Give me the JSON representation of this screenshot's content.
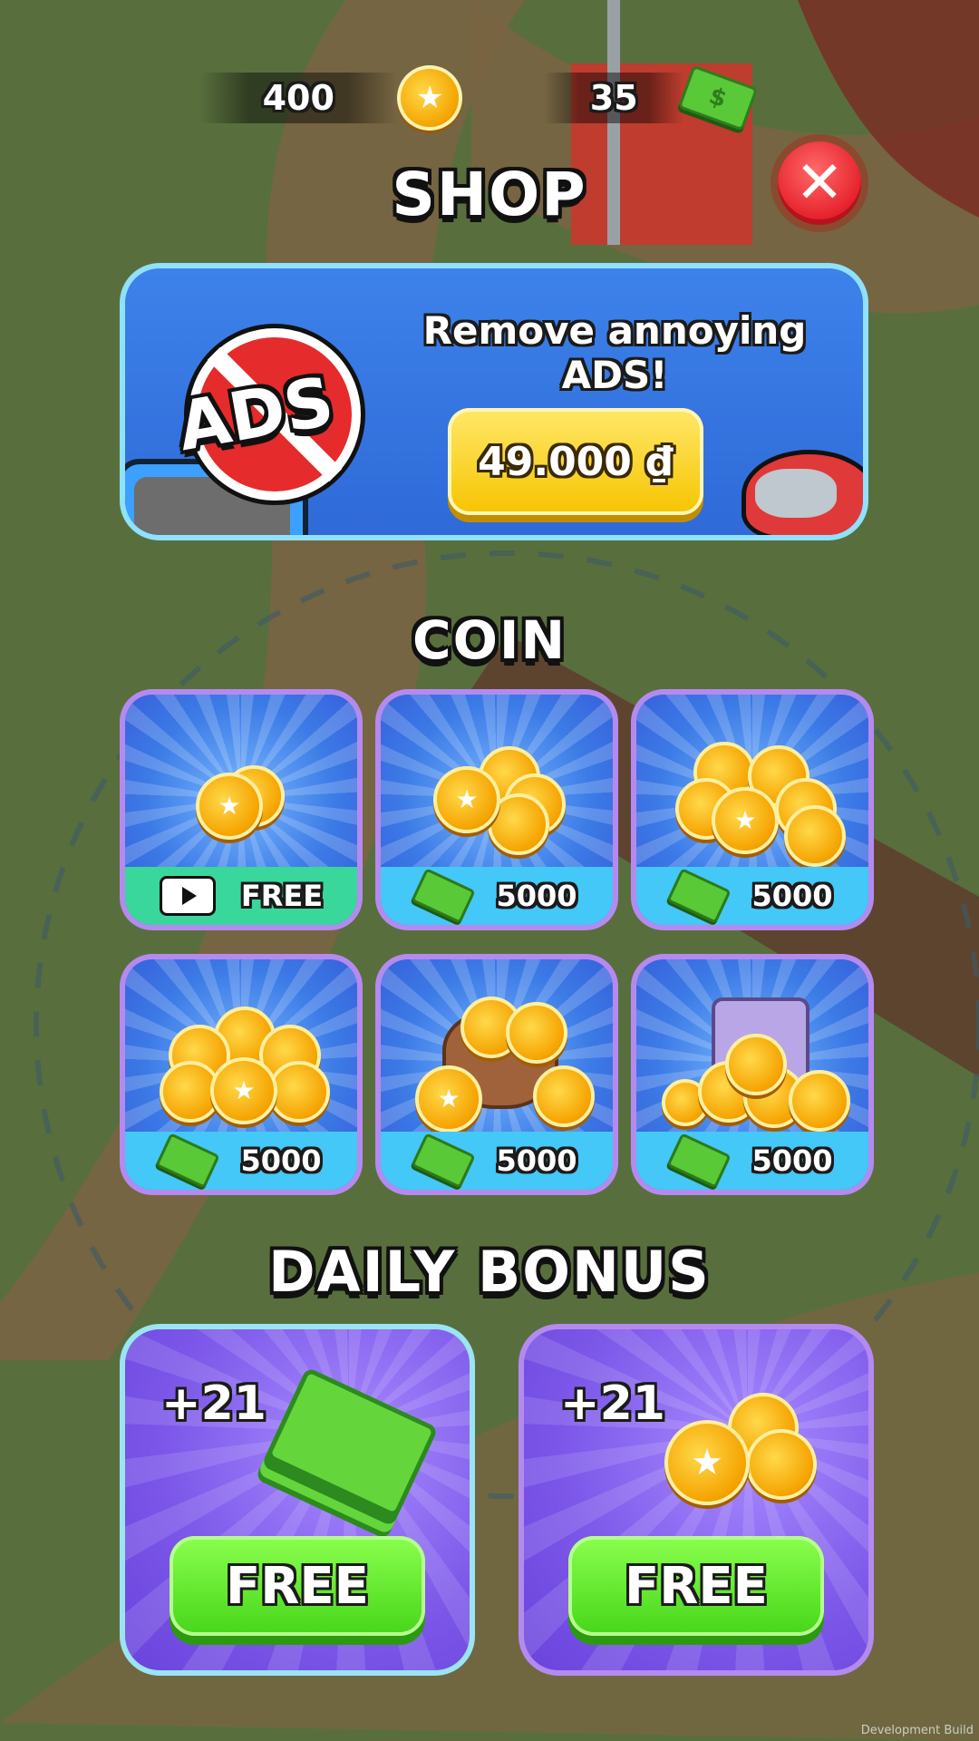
{
  "currency": {
    "coins": "400",
    "cash": "35"
  },
  "header": {
    "title": "SHOP"
  },
  "ads_offer": {
    "logo_text": "ADS",
    "headline": "Remove annoying ADS!",
    "price": "49.000 ₫"
  },
  "coin_section": {
    "title": "COIN",
    "items": [
      {
        "price": "FREE",
        "payment": "video-ad"
      },
      {
        "price": "5000",
        "payment": "cash"
      },
      {
        "price": "5000",
        "payment": "cash"
      },
      {
        "price": "5000",
        "payment": "cash"
      },
      {
        "price": "5000",
        "payment": "cash"
      },
      {
        "price": "5000",
        "payment": "cash"
      }
    ]
  },
  "daily_bonus": {
    "title": "DAILY BONUS",
    "items": [
      {
        "amount": "+21",
        "reward": "cash",
        "button": "FREE"
      },
      {
        "amount": "+21",
        "reward": "coins",
        "button": "FREE"
      }
    ]
  },
  "footer": {
    "build_label": "Development Build"
  },
  "colors": {
    "close": "#e51f2a",
    "free_button": "#46d61a",
    "price_button": "#f6c400",
    "card_border": "#b58af0"
  }
}
